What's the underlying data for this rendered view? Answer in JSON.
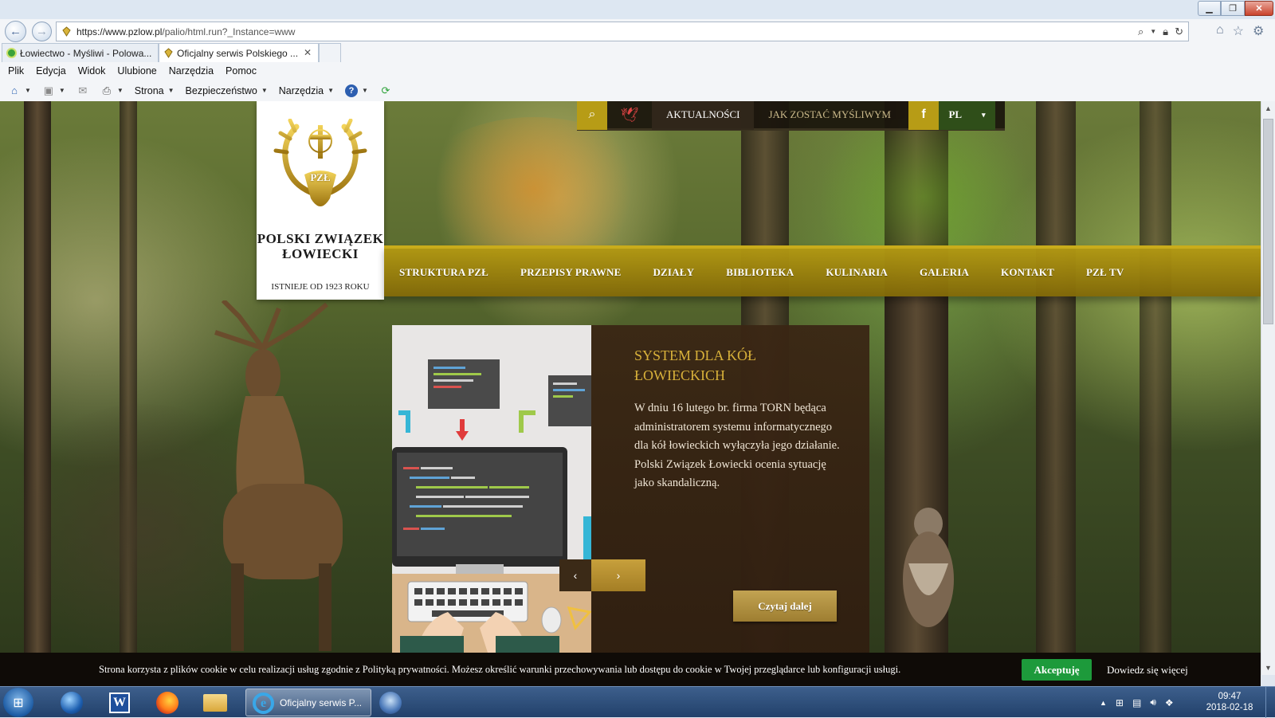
{
  "browser": {
    "address_url_main": "https://www.pzlow.pl",
    "address_url_rest": "/palio/html.run?_Instance=www",
    "tabs": [
      {
        "label": "Łowiectwo - Myśliwi - Polowa..."
      },
      {
        "label": "Oficjalny serwis Polskiego ..."
      }
    ],
    "tab_close": "✕",
    "menu": [
      "Plik",
      "Edycja",
      "Widok",
      "Ulubione",
      "Narzędzia",
      "Pomoc"
    ],
    "commands": {
      "page": "Strona",
      "safety": "Bezpieczeństwo",
      "tools": "Narzędzia"
    }
  },
  "site": {
    "org_name": "POLSKI ZWIĄZEK ŁOWIECKI",
    "org_since": "ISTNIEJE OD 1923 ROKU",
    "logo_monogram": "PZŁ",
    "top_links": {
      "news": "AKTUALNOŚCI",
      "become_hunter": "JAK ZOSTAĆ MYŚLIWYM",
      "language": "PL",
      "facebook": "f"
    },
    "main_nav": [
      "STRUKTURA PZŁ",
      "PRZEPISY PRAWNE",
      "DZIAŁY",
      "BIBLIOTEKA",
      "KULINARIA",
      "GALERIA",
      "KONTAKT",
      "PZŁ TV"
    ],
    "slide": {
      "title": "SYSTEM DLA KÓŁ ŁOWIECKICH",
      "body": "W dniu 16 lutego br. firma TORN będąca administratorem systemu informatycznego dla kół łowieckich wyłączyła jego działanie. Polski Związek Łowiecki ocenia sytuację jako skandaliczną.",
      "read_more": "Czytaj dalej"
    },
    "cookie": {
      "text": "Strona korzysta z plików cookie w celu realizacji usług zgodnie z Polityką prywatności. Możesz określić warunki przechowywania lub dostępu do cookie w Twojej przeglądarce lub konfiguracji usługi.",
      "accept": "Akceptuję",
      "more": "Dowiedz się więcej"
    }
  },
  "taskbar": {
    "ie_window": "Oficjalny serwis P...",
    "time": "09:47",
    "date": "2018-02-18"
  },
  "colors": {
    "gold": "#b79c16",
    "dark_brown": "#3a2614",
    "accept_green": "#1d9a3b"
  }
}
